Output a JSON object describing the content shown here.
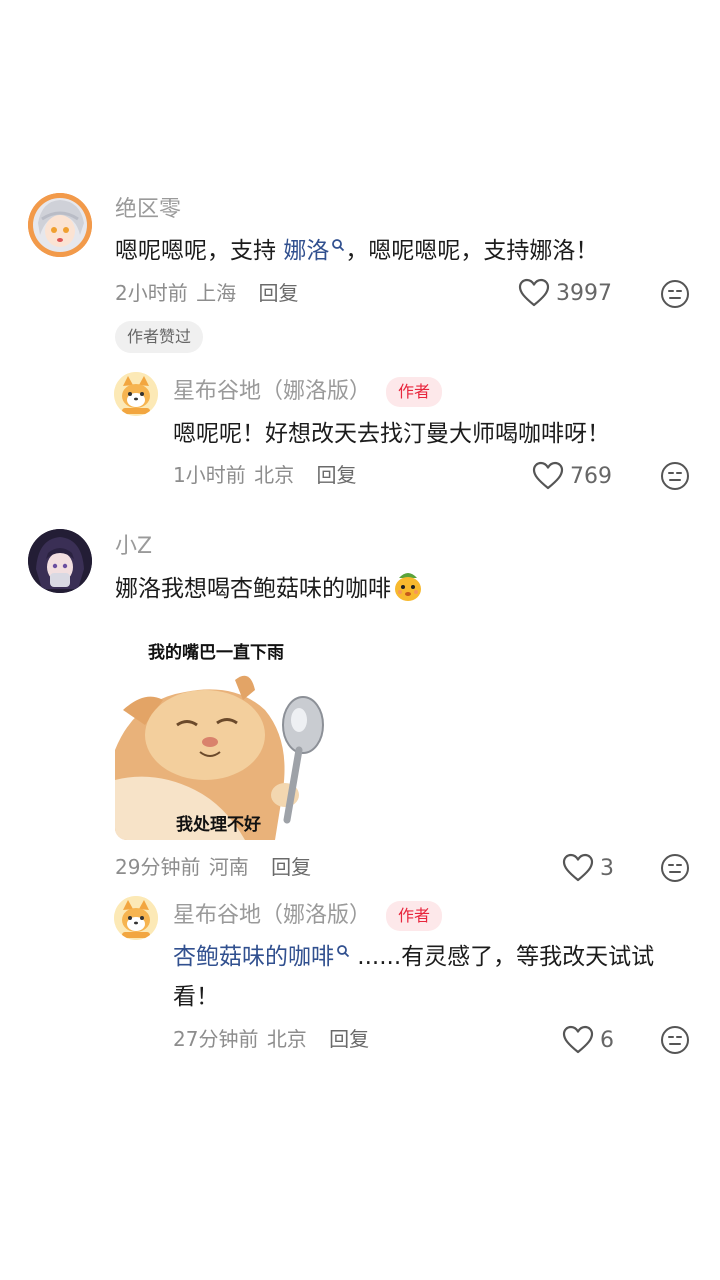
{
  "comments": [
    {
      "username": "绝区零",
      "content_prefix": "嗯呢嗯呢，支持 ",
      "link_text": "娜洛",
      "content_suffix": "，嗯呢嗯呢，支持娜洛！",
      "time": "2小时前",
      "location": "上海",
      "reply_label": "回复",
      "likes": "3997",
      "badge": "作者赞过",
      "icons": [
        "avatar-anime-girl",
        "search-icon",
        "heart-icon",
        "dislike-face-icon"
      ]
    },
    {
      "username": "星布谷地（娜洛版）",
      "author_tag": "作者",
      "content": "嗯呢呢！好想改天去找汀曼大师喝咖啡呀！",
      "time": "1小时前",
      "location": "北京",
      "reply_label": "回复",
      "likes": "769",
      "icons": [
        "avatar-shiba",
        "heart-icon",
        "dislike-face-icon"
      ]
    },
    {
      "username": "小Z",
      "content": "娜洛我想喝杏鲍菇味的咖啡",
      "emoji": "mushroom-face-emoji",
      "sticker_top_text": "我的嘴巴一直下雨",
      "sticker_bottom_text": "我处理不好",
      "time": "29分钟前",
      "location": "河南",
      "reply_label": "回复",
      "likes": "3",
      "icons": [
        "avatar-dark-hair",
        "cat-sticker-image",
        "heart-icon",
        "dislike-face-icon"
      ]
    },
    {
      "username": "星布谷地（娜洛版）",
      "author_tag": "作者",
      "link_text": "杏鲍菇味的咖啡",
      "content_line1_suffix": " ......有灵感了，等我改天试试",
      "content_line2": "看！",
      "time": "27分钟前",
      "location": "北京",
      "reply_label": "回复",
      "likes": "6",
      "icons": [
        "avatar-shiba",
        "search-icon",
        "heart-icon",
        "dislike-face-icon"
      ]
    }
  ],
  "colors": {
    "link": "#31508f",
    "author_tag_bg": "#fde8ea",
    "author_tag_text": "#e8263d",
    "meta": "#8d8d8d"
  }
}
